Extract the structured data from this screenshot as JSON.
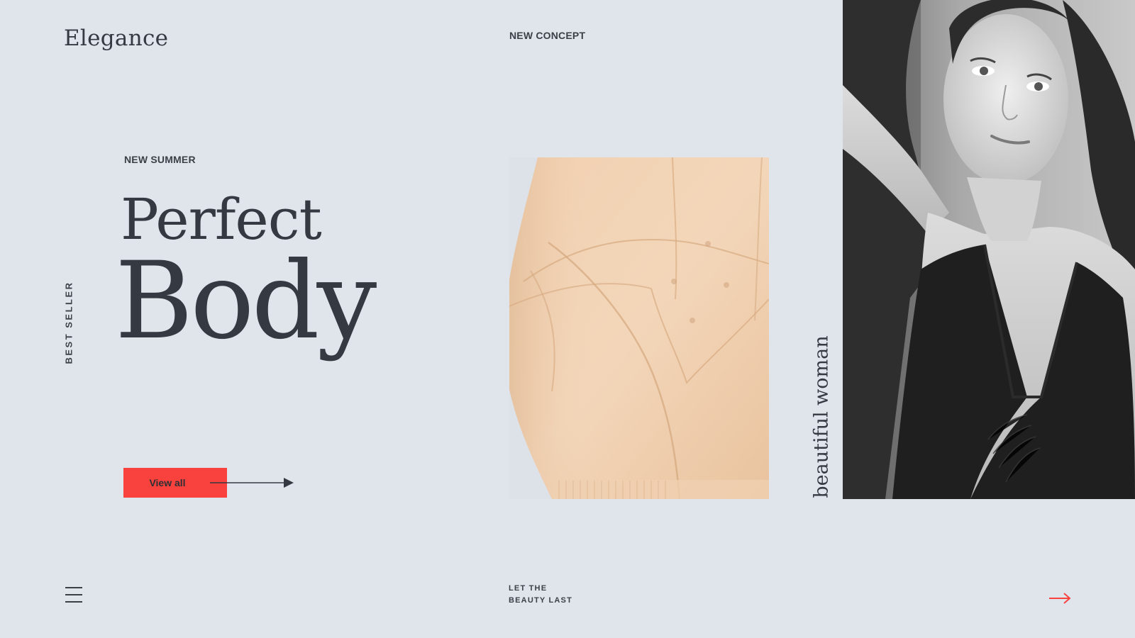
{
  "brand": {
    "logo_text": "Elegance"
  },
  "header": {
    "section_label": "NEW CONCEPT"
  },
  "hero": {
    "eyebrow": "NEW SUMMER",
    "headline_line1": "Perfect",
    "headline_line2": "Body",
    "side_label": "BEST SELLER",
    "cta_label": "View all"
  },
  "gallery": {
    "vertical_tagline": "beautiful woman"
  },
  "footer": {
    "tagline_line1": "LET THE",
    "tagline_line2": "BEAUTY LAST"
  },
  "icons": {
    "menu": "hamburger-icon",
    "cta_arrow": "long-arrow-right-icon",
    "next": "arrow-right-icon"
  },
  "colors": {
    "background": "#e0e5ec",
    "text": "#353941",
    "accent": "#f9423d"
  }
}
